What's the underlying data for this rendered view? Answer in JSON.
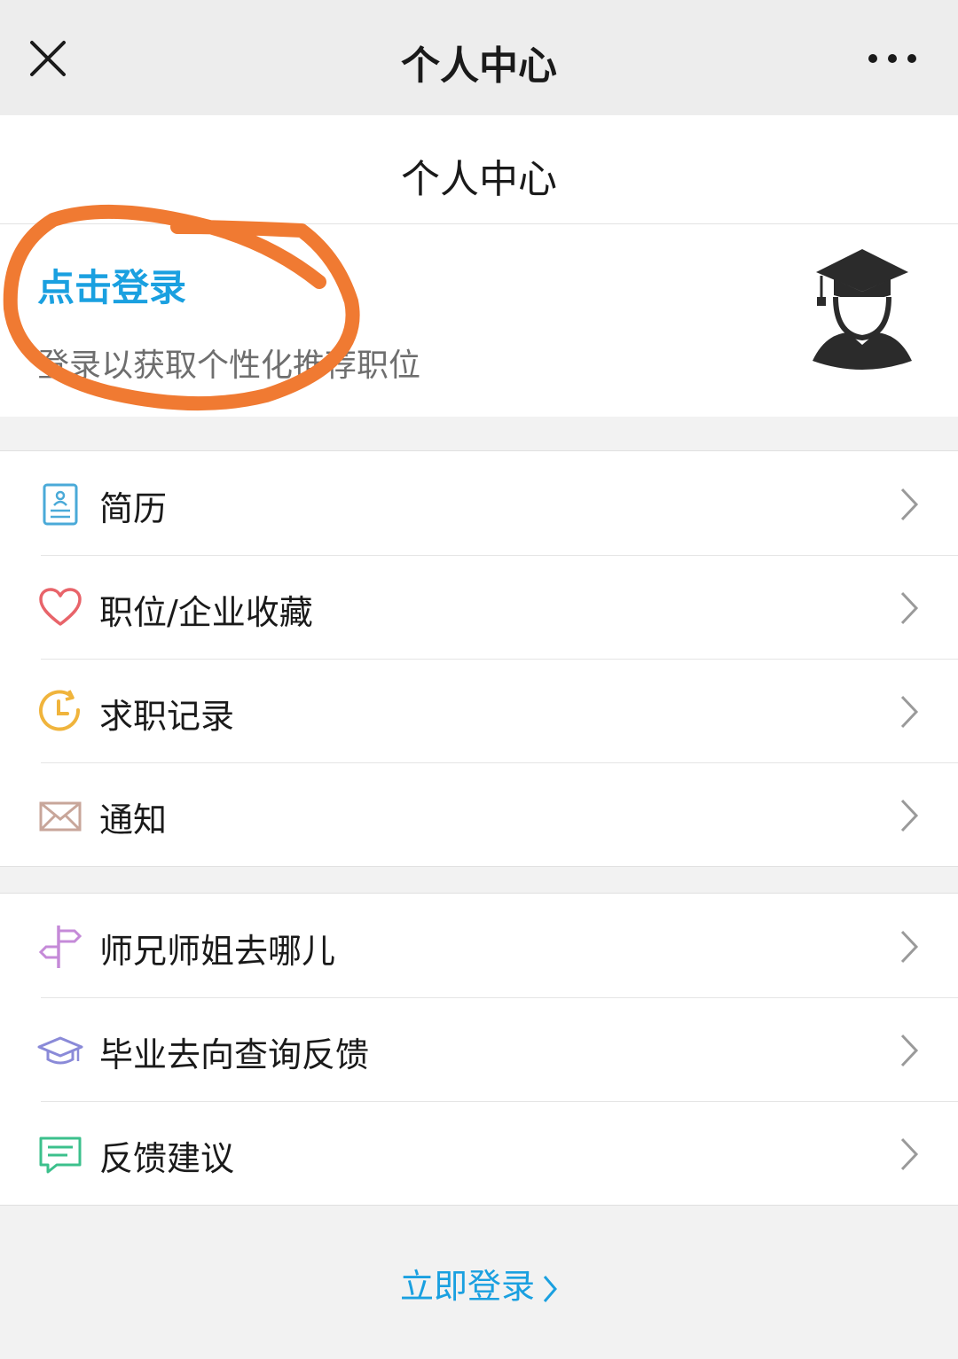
{
  "topbar": {
    "title": "个人中心",
    "close_icon": "close-icon",
    "more_icon": "more-icon"
  },
  "header": {
    "title": "个人中心"
  },
  "profile": {
    "login_link": "点击登录",
    "subtitle": "登录以获取个性化推荐职位",
    "avatar_icon": "graduate-avatar-icon"
  },
  "menu_group_1": [
    {
      "label": "简历",
      "icon": "resume-icon",
      "color": "#4aaad8"
    },
    {
      "label": "职位/企业收藏",
      "icon": "heart-icon",
      "color": "#e8646a"
    },
    {
      "label": "求职记录",
      "icon": "history-clock-icon",
      "color": "#f0b43c"
    },
    {
      "label": "通知",
      "icon": "envelope-icon",
      "color": "#c8a69a"
    }
  ],
  "menu_group_2": [
    {
      "label": "师兄师姐去哪儿",
      "icon": "signpost-icon",
      "color": "#c58ad8"
    },
    {
      "label": "毕业去向查询反馈",
      "icon": "graduation-cap-icon",
      "color": "#8a8ad8"
    },
    {
      "label": "反馈建议",
      "icon": "chat-bubble-icon",
      "color": "#3cc08c"
    }
  ],
  "bottom": {
    "login_label": "立即登录"
  },
  "colors": {
    "accent": "#1aa0e0",
    "annotation": "#f07a32"
  }
}
